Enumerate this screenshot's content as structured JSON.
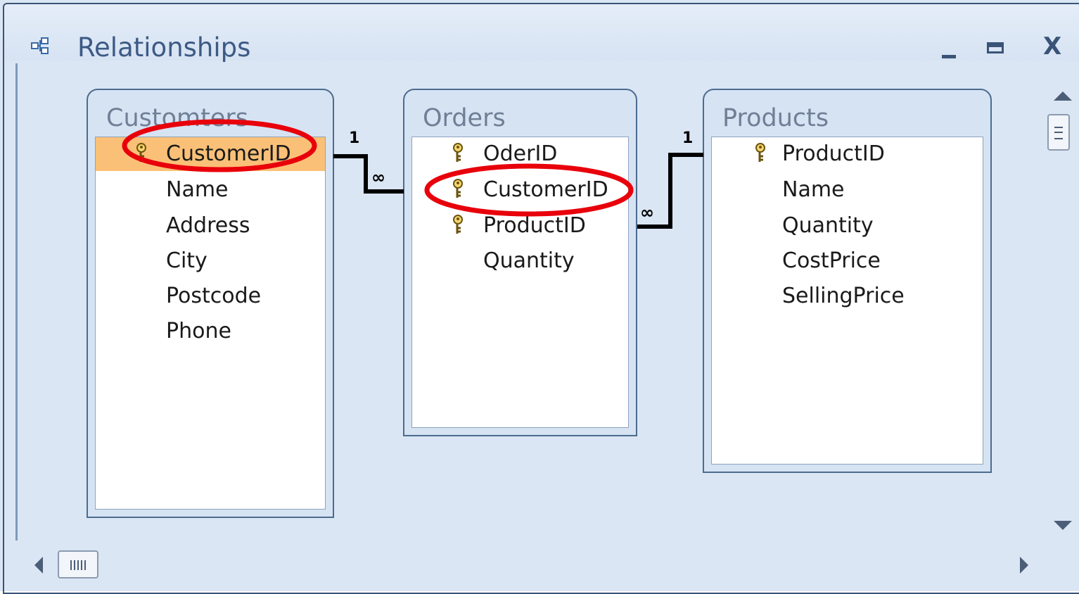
{
  "window": {
    "title": "Relationships",
    "close_label": "X",
    "icon": "relationships-icon"
  },
  "tables": [
    {
      "name": "Customters",
      "fields": [
        {
          "name": "CustomerID",
          "key": true,
          "selected": true,
          "circled": true
        },
        {
          "name": "Name",
          "key": false
        },
        {
          "name": "Address",
          "key": false
        },
        {
          "name": "City",
          "key": false
        },
        {
          "name": "Postcode",
          "key": false
        },
        {
          "name": "Phone",
          "key": false
        }
      ]
    },
    {
      "name": "Orders",
      "fields": [
        {
          "name": "OderID",
          "key": true
        },
        {
          "name": "CustomerID",
          "key": true,
          "circled": true
        },
        {
          "name": "ProductID",
          "key": true
        },
        {
          "name": "Quantity",
          "key": false
        }
      ]
    },
    {
      "name": "Products",
      "fields": [
        {
          "name": "ProductID",
          "key": true
        },
        {
          "name": "Name",
          "key": false
        },
        {
          "name": "Quantity",
          "key": false
        },
        {
          "name": "CostPrice",
          "key": false
        },
        {
          "name": "SellingPrice",
          "key": false
        }
      ]
    }
  ],
  "relationships": [
    {
      "from": "Customters.CustomerID",
      "to": "Orders.CustomerID",
      "one_label": "1",
      "many_label": "∞"
    },
    {
      "from": "Products.ProductID",
      "to": "Orders.ProductID",
      "one_label": "1",
      "many_label": "∞"
    }
  ],
  "highlight_color": "#e8000b",
  "selection_color": "#fbc077"
}
